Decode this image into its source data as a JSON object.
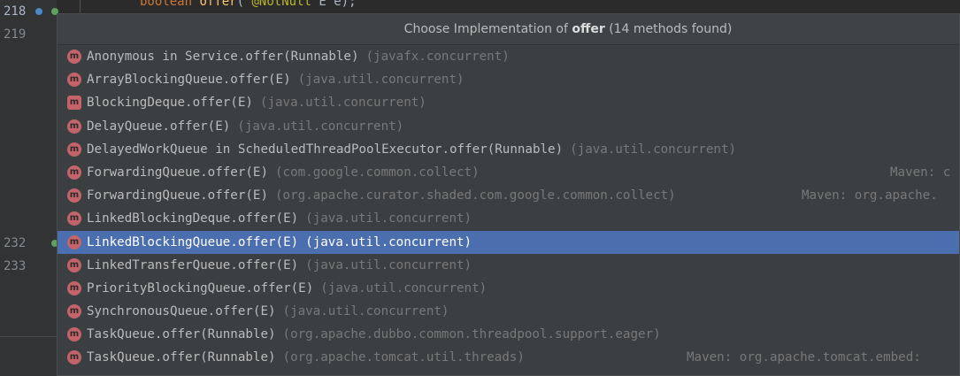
{
  "editor": {
    "line_numbers": [
      "218",
      "219",
      "232",
      "233"
    ],
    "code_line": {
      "kw": "boolean",
      "fn": "offer",
      "rest_open": "(",
      "ann": "@NotNull",
      "rest_close": " E e);"
    }
  },
  "popup": {
    "title_prefix": "Choose Implementation of",
    "title_method": "offer",
    "title_suffix": "(14 methods found)",
    "icon_letter": "m",
    "selected_index": 8,
    "items": [
      {
        "sig": "Anonymous in Service.offer(Runnable)",
        "pkg": "(javafx.concurrent)",
        "maven": ""
      },
      {
        "sig": "ArrayBlockingQueue.offer(E)",
        "pkg": "(java.util.concurrent)",
        "maven": ""
      },
      {
        "sig": "BlockingDeque.offer(E)",
        "pkg": "(java.util.concurrent)",
        "maven": ""
      },
      {
        "sig": "DelayQueue.offer(E)",
        "pkg": "(java.util.concurrent)",
        "maven": ""
      },
      {
        "sig": "DelayedWorkQueue in ScheduledThreadPoolExecutor.offer(Runnable)",
        "pkg": "(java.util.concurrent)",
        "maven": ""
      },
      {
        "sig": "ForwardingQueue.offer(E)",
        "pkg": "(com.google.common.collect)",
        "maven": "Maven: c"
      },
      {
        "sig": "ForwardingQueue.offer(E)",
        "pkg": "(org.apache.curator.shaded.com.google.common.collect)",
        "maven": "Maven: org.apache."
      },
      {
        "sig": "LinkedBlockingDeque.offer(E)",
        "pkg": "(java.util.concurrent)",
        "maven": ""
      },
      {
        "sig": "LinkedBlockingQueue.offer(E)",
        "pkg": "(java.util.concurrent)",
        "maven": ""
      },
      {
        "sig": "LinkedTransferQueue.offer(E)",
        "pkg": "(java.util.concurrent)",
        "maven": ""
      },
      {
        "sig": "PriorityBlockingQueue.offer(E)",
        "pkg": "(java.util.concurrent)",
        "maven": ""
      },
      {
        "sig": "SynchronousQueue.offer(E)",
        "pkg": "(java.util.concurrent)",
        "maven": ""
      },
      {
        "sig": "TaskQueue.offer(Runnable)",
        "pkg": "(org.apache.dubbo.common.threadpool.support.eager)",
        "maven": ""
      },
      {
        "sig": "TaskQueue.offer(Runnable)",
        "pkg": "(org.apache.tomcat.util.threads)",
        "maven": "Maven: org.apache.tomcat.embed:"
      }
    ]
  },
  "colors": {
    "selection": "#4b6eaf",
    "method_icon": "#c4646a",
    "popup_bg": "#3c3f41",
    "editor_bg": "#2b2b2b"
  }
}
